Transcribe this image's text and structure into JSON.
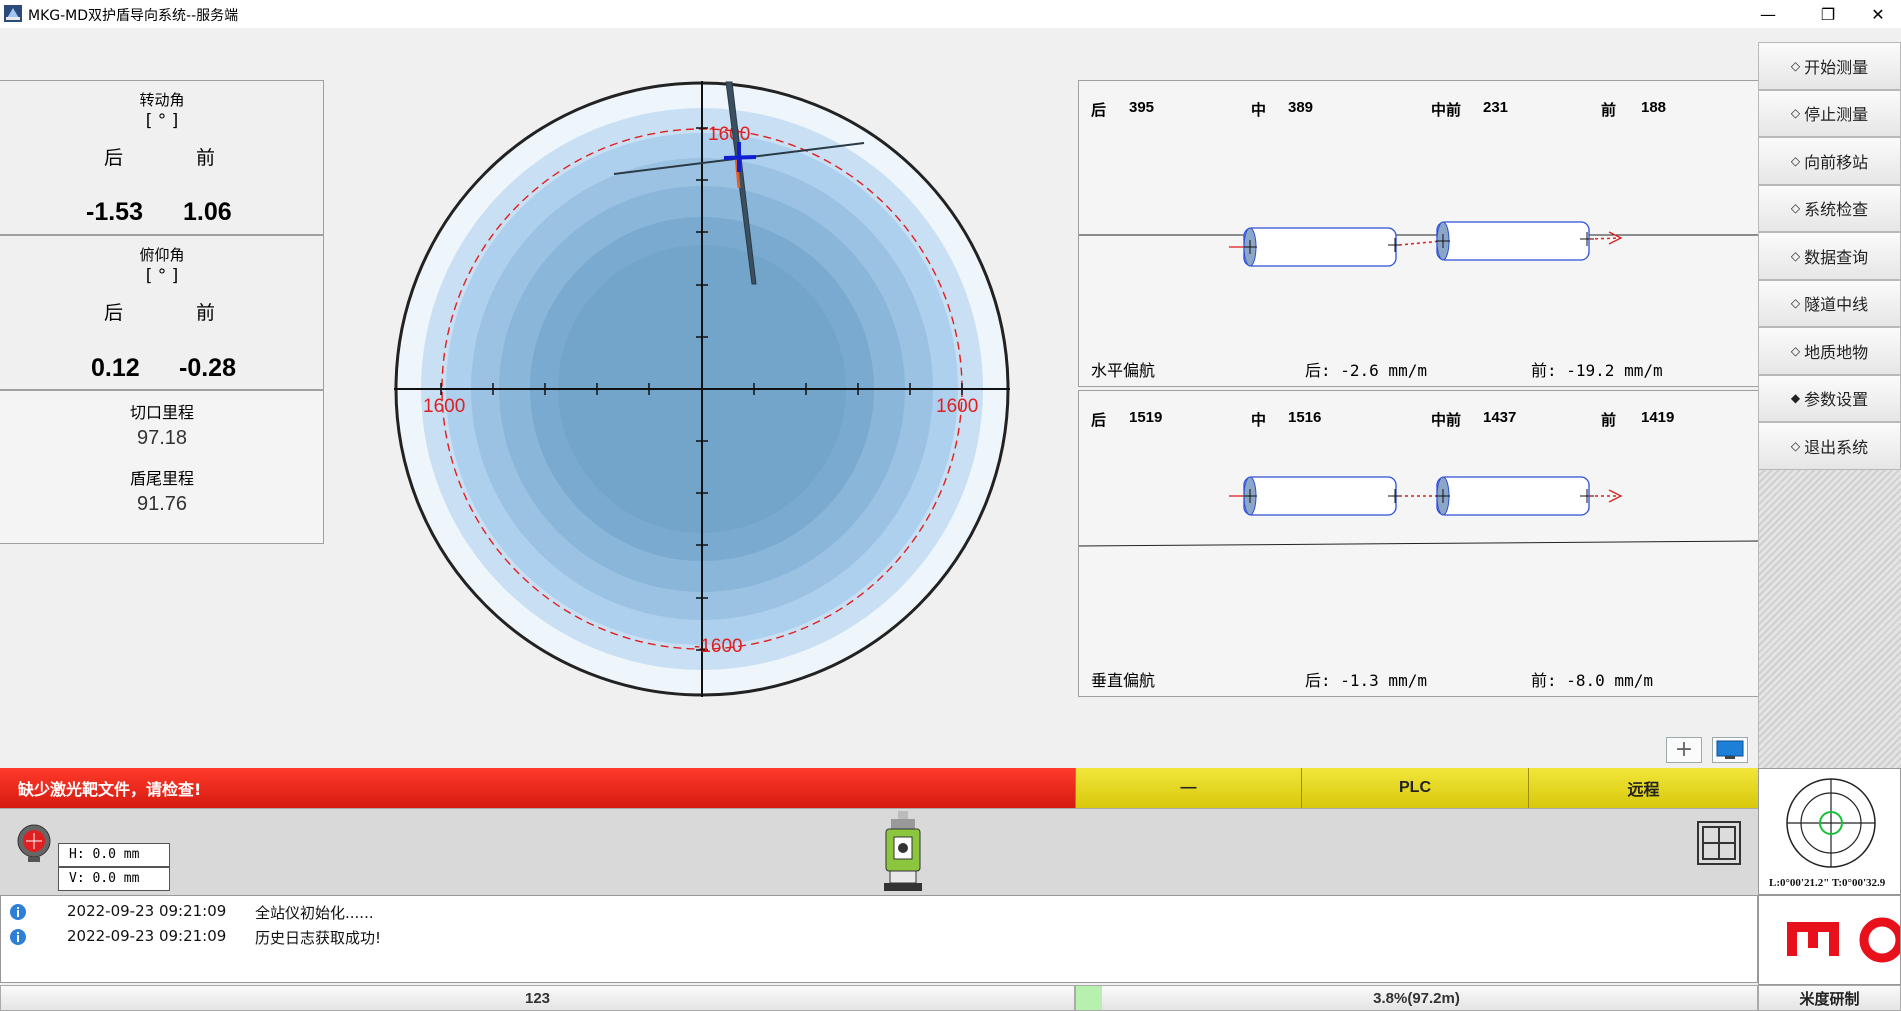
{
  "window": {
    "title": "MKG-MD双护盾导向系统--服务端",
    "minimize_glyph": "—",
    "maximize_glyph": "❐",
    "close_glyph": "✕"
  },
  "left_panel": {
    "rotation": {
      "label": "转动角",
      "unit": "[ ° ]",
      "back_label": "后",
      "front_label": "前",
      "back_value": "-1.53",
      "front_value": "1.06"
    },
    "pitch": {
      "label": "俯仰角",
      "unit": "[ ° ]",
      "back_label": "后",
      "front_label": "前",
      "back_value": "0.12",
      "front_value": "-0.28"
    },
    "cut_mileage": {
      "label": "切口里程",
      "value": "97.18"
    },
    "tail_mileage": {
      "label": "盾尾里程",
      "value": "91.76"
    }
  },
  "target": {
    "top_label": "1600",
    "left_label": "1600",
    "right_label": "1600",
    "bottom_label": "-1600",
    "ring_color": "#e02020"
  },
  "horizontal": {
    "head": {
      "back_label": "后",
      "back_value": "395",
      "mid_label": "中",
      "mid_value": "389",
      "midfront_label": "中前",
      "midfront_value": "231",
      "front_label": "前",
      "front_value": "188"
    },
    "title": "水平偏航",
    "back_text": "后: -2.6 mm/m",
    "front_text": "前: -19.2 mm/m"
  },
  "vertical": {
    "head": {
      "back_label": "后",
      "back_value": "1519",
      "mid_label": "中",
      "mid_value": "1516",
      "midfront_label": "中前",
      "midfront_value": "1437",
      "front_label": "前",
      "front_value": "1419"
    },
    "title": "垂直偏航",
    "back_text": "后: -1.3 mm/m",
    "front_text": "前: -8.0 mm/m"
  },
  "menu": {
    "items": [
      {
        "label": "开始测量",
        "bullet": "◇"
      },
      {
        "label": "停止测量",
        "bullet": "◇"
      },
      {
        "label": "向前移站",
        "bullet": "◇"
      },
      {
        "label": "系统检查",
        "bullet": "◇"
      },
      {
        "label": "数据查询",
        "bullet": "◇"
      },
      {
        "label": "隧道中线",
        "bullet": "◇"
      },
      {
        "label": "地质地物",
        "bullet": "◇"
      },
      {
        "label": "参数设置",
        "bullet": "◆"
      },
      {
        "label": "退出系统",
        "bullet": "◇"
      }
    ]
  },
  "alert": {
    "text": "缺少激光靶文件，请检查!"
  },
  "status": {
    "cell1": "—",
    "cell2": "PLC",
    "cell3": "远程"
  },
  "instrument": {
    "h_text": "H: 0.0 mm",
    "v_text": "V: 0.0 mm"
  },
  "log": [
    {
      "time": "2022-09-23 09:21:09",
      "message": "全站仪初始化......"
    },
    {
      "time": "2022-09-23 09:21:09",
      "message": "历史日志获取成功!"
    }
  ],
  "footer": {
    "left": "123",
    "progress_text": "3.8%(97.2m)",
    "progress": 0.038
  },
  "laser": {
    "angle_text": "L:0°00'21.2\" T:0°00'32.9"
  },
  "brand": {
    "text": "米度研制"
  },
  "colors": {
    "alert_red": "#e62a1c",
    "status_yellow": "#e6d81e",
    "accent_blue": "#4a7fd0",
    "logo_red": "#e8101a"
  }
}
